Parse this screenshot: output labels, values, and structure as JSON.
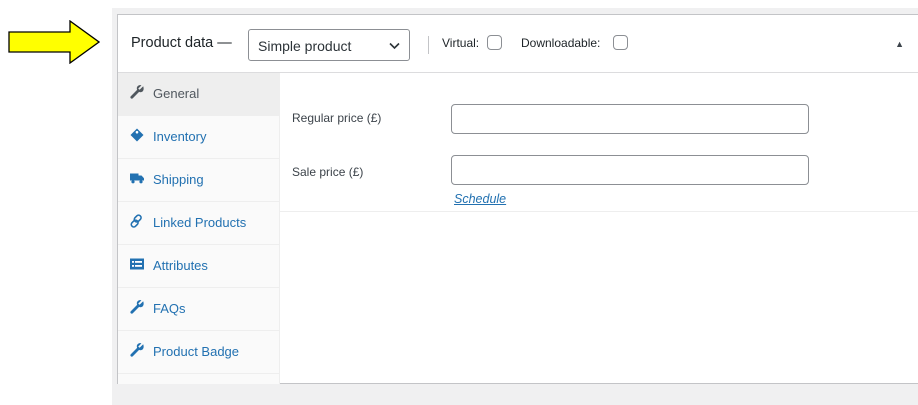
{
  "panel": {
    "title": "Product data —",
    "product_type": {
      "selected": "Simple product",
      "options": [
        "Simple product"
      ]
    },
    "virtual_label": "Virtual:",
    "virtual_checked": false,
    "downloadable_label": "Downloadable:",
    "downloadable_checked": false,
    "toggle_glyph": "▲"
  },
  "tabs": [
    {
      "label": "General",
      "icon": "wrench-icon",
      "active": true
    },
    {
      "label": "Inventory",
      "icon": "tag-icon",
      "active": false
    },
    {
      "label": "Shipping",
      "icon": "truck-icon",
      "active": false
    },
    {
      "label": "Linked Products",
      "icon": "link-icon",
      "active": false
    },
    {
      "label": "Attributes",
      "icon": "list-view-icon",
      "active": false
    },
    {
      "label": "FAQs",
      "icon": "wrench-icon",
      "active": false
    },
    {
      "label": "Product Badge",
      "icon": "wrench-icon",
      "active": false
    }
  ],
  "general": {
    "regular_price_label": "Regular price (£)",
    "regular_price_value": "",
    "sale_price_label": "Sale price (£)",
    "sale_price_value": "",
    "schedule_link": "Schedule"
  },
  "colors": {
    "arrow_fill": "#ffff00",
    "link": "#2271b1",
    "active_tab_bg": "#eeeeee"
  }
}
